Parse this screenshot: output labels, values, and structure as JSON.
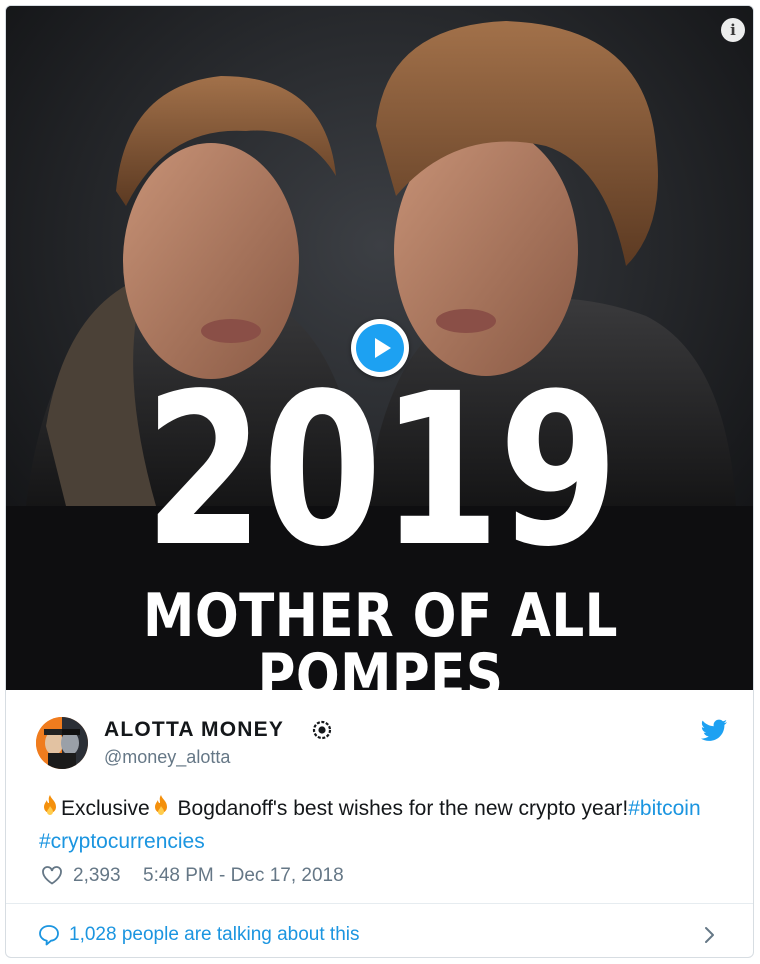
{
  "media": {
    "info_icon": "info-icon",
    "play_icon": "play-icon",
    "year_text": "2019",
    "subtitle_text": "MOTHER OF ALL POMPES"
  },
  "author": {
    "display_name": "ALOTTA MONEY",
    "handle": "@money_alotta",
    "verified_icon": "gear-badge-icon",
    "brand_icon": "twitter-bird-icon"
  },
  "tweet": {
    "text_exclusive": "Exclusive",
    "text_body": " Bogdanoff's best wishes for the new crypto year!",
    "hashtag_1": "#bitcoin",
    "hashtag_2": "#cryptocurrencies",
    "emoji_icon": "fire-icon"
  },
  "meta": {
    "likes": "2,393",
    "timestamp": "5:48 PM - Dec 17, 2018"
  },
  "footer": {
    "talking_label": "1,028 people are talking about this"
  },
  "colors": {
    "accent": "#1b95e0",
    "twitter_blue": "#1da1f2",
    "text": "#14171a",
    "muted": "#657786"
  }
}
